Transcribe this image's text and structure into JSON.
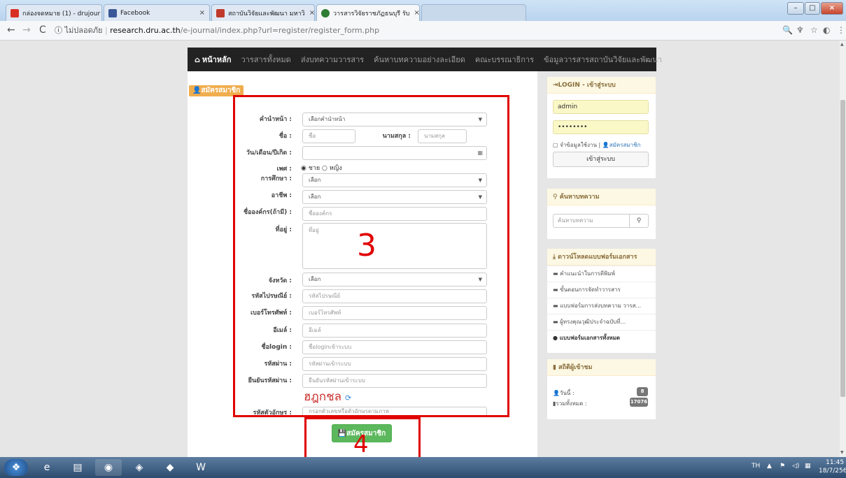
{
  "browser": {
    "tabs": [
      {
        "title": "กล่องจดหมาย (1) - drujour",
        "color": "#d93025"
      },
      {
        "title": "Facebook",
        "color": "#3b5998"
      },
      {
        "title": "สถาบันวิจัยและพัฒนา มหาวิ",
        "color": "#c0392b"
      },
      {
        "title": "วารสารวิจัยราชภัฏธนบุรี รับ",
        "color": "#2e7d32"
      }
    ],
    "url_security": "ไม่ปลอดภัย",
    "url_host": "research.dru.ac.th",
    "url_path": "/e-journal/index.php?url=register/register_form.php"
  },
  "navbar": {
    "home": "หน้าหลัก",
    "items": [
      "วารสารทั้งหมด",
      "ส่งบทความวารสาร",
      "ค้นหาบทความอย่างละเอียด",
      "คณะบรรณาธิการ",
      "ข้อมูลวารสารสถาบันวิจัยและพัฒนา"
    ]
  },
  "form": {
    "panel_title": "สมัครสมาชิก",
    "fields": {
      "prefix": {
        "label": "คำนำหน้า :",
        "value": "เลือกคำนำหน้า"
      },
      "name": {
        "label": "ชื่อ :",
        "placeholder": "ชื่อ"
      },
      "surname": {
        "label": "นามสกุล :",
        "placeholder": "นามสกุล"
      },
      "birthdate": {
        "label": "วัน/เดือน/ปีเกิด :"
      },
      "gender": {
        "label": "เพศ :",
        "male": "ชาย",
        "female": "หญิง"
      },
      "education": {
        "label": "การศึกษา :",
        "value": "เลือก"
      },
      "occupation": {
        "label": "อาชีพ :",
        "value": "เลือก"
      },
      "organization": {
        "label": "ชื่อองค์กร(ถ้ามี) :",
        "placeholder": "ชื่อองค์กร"
      },
      "address": {
        "label": "ที่อยู่ :",
        "placeholder": "ที่อยู่"
      },
      "province": {
        "label": "จังหวัด :",
        "value": "เลือก"
      },
      "postcode": {
        "label": "รหัสไปรษณีย์ :",
        "placeholder": "รหัสไปรษณีย์"
      },
      "phone": {
        "label": "เบอร์โทรศัพท์ :",
        "placeholder": "เบอร์โทรศัพท์"
      },
      "email": {
        "label": "อีเมล์ :",
        "placeholder": "อีเมล์"
      },
      "login": {
        "label": "ชื่อlogin :",
        "placeholder": "ชื่อloginเข้าระบบ"
      },
      "password": {
        "label": "รหัสผ่าน :",
        "placeholder": "รหัสผ่านเข้าระบบ"
      },
      "confirm": {
        "label": "ยืนยันรหัสผ่าน :",
        "placeholder": "ยืนยันรหัสผ่านเข้าระบบ"
      },
      "captcha": {
        "label": "รหัสตัวอักษร :",
        "image_text": "ฮฎกชล",
        "placeholder": "กรอกตัวเลขหรือตัวอักษรตามภาพ"
      }
    },
    "submit_label": "สมัครสมาชิก"
  },
  "annotations": {
    "box3": "3",
    "box4": "4"
  },
  "sidebar": {
    "login": {
      "title": "LOGIN - เข้าสู่ระบบ",
      "username": "admin",
      "password": "••••••••",
      "remember": "จำข้อมูลใช้งาน",
      "register": "สมัครสมาชิก",
      "button": "เข้าสู่ระบบ"
    },
    "search": {
      "title": "ค้นหาบทความ",
      "placeholder": "ค้นหาบทความ"
    },
    "downloads": {
      "title": "ดาวน์โหลดแบบฟอร์มเอกสาร",
      "items": [
        "คำแนะนำในการตีพิมพ์",
        "ขั้นตอนการจัดทำวารสาร",
        "แบบฟอร์มการส่งบทความ วารส...",
        "ผู้ทรงคุณวุฒิประจำฉบับที่..."
      ],
      "all": "แบบฟอร์มเอกสารทั้งหมด"
    },
    "stats": {
      "title": "สถิติผู้เข้าชม",
      "today_label": "วันนี้ :",
      "today": "8",
      "total_label": "รวมทั้งหมด :",
      "total": "17076"
    }
  },
  "taskbar": {
    "lang": "TH",
    "time": "11:45",
    "date": "18/7/2560"
  }
}
